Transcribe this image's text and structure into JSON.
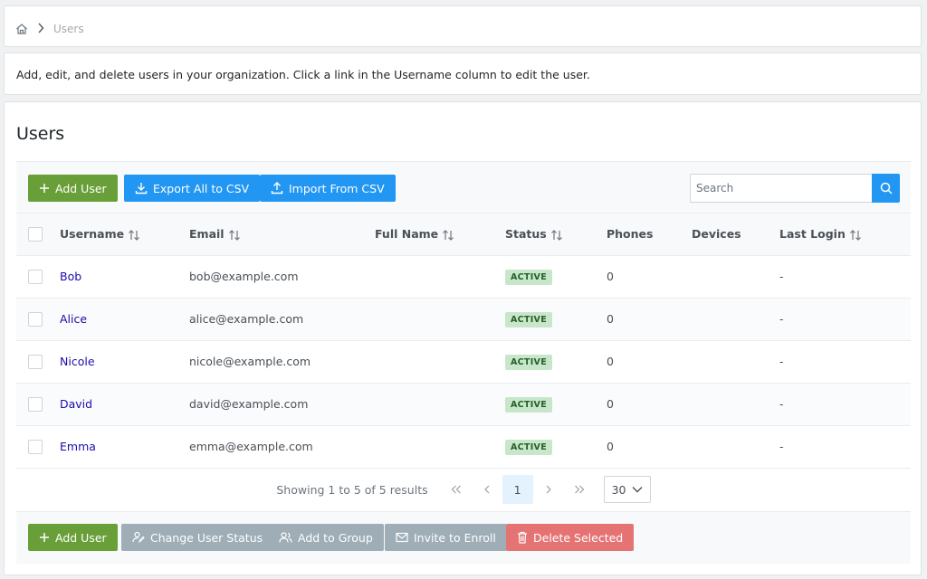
{
  "breadcrumb": {
    "home_icon": "home-icon",
    "current": "Users"
  },
  "description": "Add, edit, and delete users in your organization. Click a link in the Username column to edit the user.",
  "page_title": "Users",
  "toolbar": {
    "add_user": "Add User",
    "export_csv": "Export All to CSV",
    "import_csv": "Import From CSV",
    "search_placeholder": "Search"
  },
  "table": {
    "columns": {
      "username": "Username",
      "email": "Email",
      "full_name": "Full Name",
      "status": "Status",
      "phones": "Phones",
      "devices": "Devices",
      "last_login": "Last Login"
    },
    "rows": [
      {
        "username": "Bob",
        "email": "bob@example.com",
        "full_name": "",
        "status": "ACTIVE",
        "phones": "0",
        "devices": "",
        "last_login": "-"
      },
      {
        "username": "Alice",
        "email": "alice@example.com",
        "full_name": "",
        "status": "ACTIVE",
        "phones": "0",
        "devices": "",
        "last_login": "-"
      },
      {
        "username": "Nicole",
        "email": "nicole@example.com",
        "full_name": "",
        "status": "ACTIVE",
        "phones": "0",
        "devices": "",
        "last_login": "-"
      },
      {
        "username": "David",
        "email": "david@example.com",
        "full_name": "",
        "status": "ACTIVE",
        "phones": "0",
        "devices": "",
        "last_login": "-"
      },
      {
        "username": "Emma",
        "email": "emma@example.com",
        "full_name": "",
        "status": "ACTIVE",
        "phones": "0",
        "devices": "",
        "last_login": "-"
      }
    ]
  },
  "pagination": {
    "summary": "Showing 1 to 5 of 5 results",
    "current_page": "1",
    "rows_per_page": "30"
  },
  "bottom_actions": {
    "add_user": "Add User",
    "change_status": "Change User Status",
    "add_to_group": "Add to Group",
    "invite": "Invite to Enroll",
    "delete": "Delete Selected"
  },
  "colors": {
    "green": "#689f38",
    "blue": "#2196f3",
    "gray": "#9eadb6",
    "red": "#e57373",
    "active_badge_bg": "#c8e6c9",
    "link": "#1a0dab"
  }
}
